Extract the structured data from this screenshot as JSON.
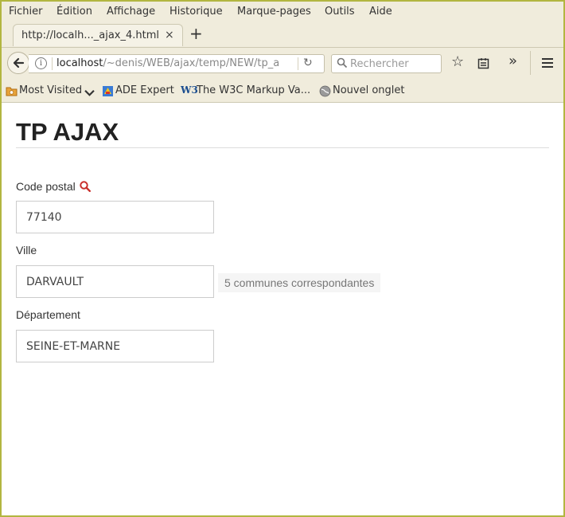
{
  "menubar": {
    "items": [
      "Fichier",
      "Édition",
      "Affichage",
      "Historique",
      "Marque-pages",
      "Outils",
      "Aide"
    ]
  },
  "tab": {
    "title": "http://localh..._ajax_4.html",
    "close": "×",
    "new_tab": "+"
  },
  "navbar": {
    "url_host": "localhost",
    "url_path": "/~denis/WEB/ajax/temp/NEW/tp_a",
    "search_placeholder": "Rechercher"
  },
  "bookmarks": {
    "items": [
      "Most Visited",
      "ADE Expert",
      "The W3C Markup Va...",
      "Nouvel onglet"
    ]
  },
  "page": {
    "title": "TP AJAX",
    "code_postal_label": "Code postal",
    "code_postal_value": "77140",
    "ville_label": "Ville",
    "ville_value": "DARVAULT",
    "ville_hint": "5 communes correspondantes",
    "departement_label": "Département",
    "departement_value": "SEINE-ET-MARNE"
  },
  "colors": {
    "window_border": "#b2b640",
    "chrome_bg": "#f0ecdc",
    "search_icon": "#c9302c"
  },
  "icons": [
    "back-arrow-icon",
    "info-icon",
    "reload-icon",
    "search-icon",
    "star-icon",
    "reading-list-icon",
    "overflow-chevron-icon",
    "hamburger-menu-icon",
    "folder-icon",
    "ade-icon",
    "w3c-icon",
    "globe-icon",
    "magnifier-icon"
  ]
}
